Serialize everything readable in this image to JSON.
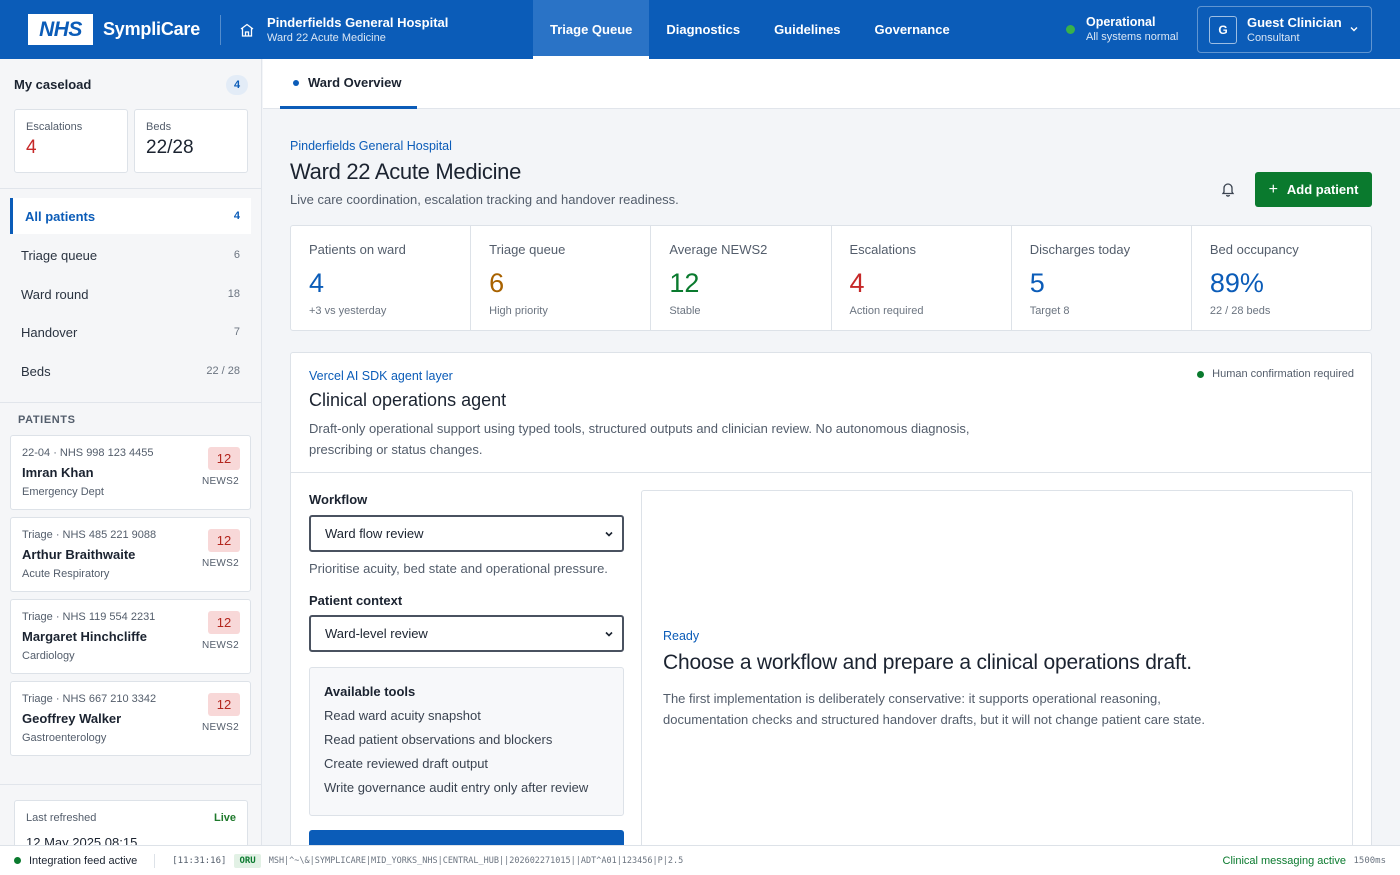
{
  "header": {
    "logo_text": "NHS",
    "brand": "SympliCare",
    "hospital_name": "Pinderfields General Hospital",
    "ward": "Ward 22 Acute Medicine",
    "nav": [
      "Triage Queue",
      "Diagnostics",
      "Guidelines",
      "Governance"
    ],
    "active_nav": "Triage Queue",
    "status_title": "Operational",
    "status_sub": "All systems normal",
    "user_initial": "G",
    "user_name": "Guest Clinician",
    "user_role": "Consultant"
  },
  "sidebar": {
    "caseload_title": "My caseload",
    "caseload_count": "4",
    "kpis": [
      {
        "label": "Escalations",
        "value": "4",
        "color": "#c62828"
      },
      {
        "label": "Beds",
        "value": "22/28",
        "color": "#1b2330"
      }
    ],
    "nav": [
      {
        "label": "All patients",
        "count": "4",
        "active": true
      },
      {
        "label": "Triage queue",
        "count": "6"
      },
      {
        "label": "Ward round",
        "count": "18"
      },
      {
        "label": "Handover",
        "count": "7"
      },
      {
        "label": "Beds",
        "count": "22 / 28"
      }
    ],
    "patients_heading": "PATIENTS",
    "patients": [
      {
        "id": "22-04 · NHS 998 123 4455",
        "name": "Imran Khan",
        "dept": "Emergency Dept",
        "score": "12",
        "score_label": "NEWS2"
      },
      {
        "id": "Triage · NHS 485 221 9088",
        "name": "Arthur Braithwaite",
        "dept": "Acute Respiratory",
        "score": "12",
        "score_label": "NEWS2"
      },
      {
        "id": "Triage · NHS 119 554 2231",
        "name": "Margaret Hinchcliffe",
        "dept": "Cardiology",
        "score": "12",
        "score_label": "NEWS2"
      },
      {
        "id": "Triage · NHS 667 210 3342",
        "name": "Geoffrey Walker",
        "dept": "Gastroenterology",
        "score": "12",
        "score_label": "NEWS2"
      }
    ],
    "refresh_label": "Last refreshed",
    "refresh_live": "Live",
    "refresh_time": "12 May 2025 08:15"
  },
  "main": {
    "tab": "Ward Overview",
    "eyebrow": "Pinderfields General Hospital",
    "title": "Ward 22 Acute Medicine",
    "subtitle": "Live care coordination, escalation tracking and handover readiness.",
    "add_button": "Add patient",
    "stats": [
      {
        "label": "Patients on ward",
        "value": "4",
        "sub": "+3 vs yesterday",
        "color": "#0b5cb8"
      },
      {
        "label": "Triage queue",
        "value": "6",
        "sub": "High priority",
        "color": "#a86200"
      },
      {
        "label": "Average NEWS2",
        "value": "12",
        "sub": "Stable",
        "color": "#0a7a2e"
      },
      {
        "label": "Escalations",
        "value": "4",
        "sub": "Action required",
        "color": "#c62828"
      },
      {
        "label": "Discharges today",
        "value": "5",
        "sub": "Target 8",
        "color": "#0b5cb8"
      },
      {
        "label": "Bed occupancy",
        "value": "89%",
        "sub": "22 / 28 beds",
        "color": "#0b5cb8"
      }
    ]
  },
  "agent": {
    "eyebrow": "Vercel AI SDK agent layer",
    "title": "Clinical operations agent",
    "description": "Draft-only operational support using typed tools, structured outputs and clinician review. No autonomous diagnosis, prescribing or status changes.",
    "confirmation": "Human confirmation required",
    "workflow_label": "Workflow",
    "workflow_value": "Ward flow review",
    "workflow_hint": "Prioritise acuity, bed state and operational pressure.",
    "context_label": "Patient context",
    "context_value": "Ward-level review",
    "tools_heading": "Available tools",
    "tools": [
      "Read ward acuity snapshot",
      "Read patient observations and blockers",
      "Create reviewed draft output",
      "Write governance audit entry only after review"
    ],
    "output_status": "Ready",
    "output_title": "Choose a workflow and prepare a clinical operations draft.",
    "output_desc": "The first implementation is deliberately conservative: it supports operational reasoning, documentation checks and structured handover drafts, but it will not change patient care state."
  },
  "statusbar": {
    "feed": "Integration feed active",
    "time": "[11:31:16]",
    "type": "ORU",
    "message": "MSH|^~\\&|SYMPLICARE|MID_YORKS_NHS|CENTRAL_HUB||202602271015||ADT^A01|123456|P|2.5",
    "right": "Clinical messaging active",
    "ms": "1500ms"
  }
}
